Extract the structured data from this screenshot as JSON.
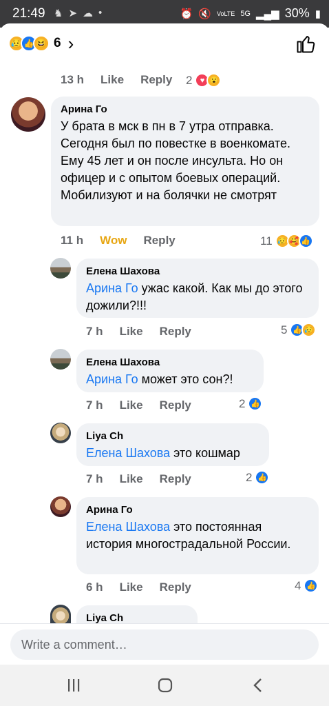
{
  "status": {
    "time": "21:49",
    "network": "5G",
    "lte": "VoLTE",
    "battery": "30%"
  },
  "header": {
    "reaction_count": "6"
  },
  "top_meta": {
    "time": "13 h",
    "like": "Like",
    "reply": "Reply",
    "count": "2"
  },
  "comments": [
    {
      "author": "Арина Го",
      "text": "У брата в мск в пн в 7 утра отправка. Сегодня был по повестке в военкомате. Ему 45 лет и он после инсульта. Но он офицер и с опытом боевых операций. Мобилизуют и на болячки не смотрят",
      "time": "11 h",
      "reaction": "Wow",
      "reply": "Reply",
      "count": "11"
    },
    {
      "author": "Елена Шахова",
      "mention": "Арина Го",
      "text": " ужас какой. Как мы до этого дожили?!!!",
      "time": "7 h",
      "like": "Like",
      "reply": "Reply",
      "count": "5"
    },
    {
      "author": "Елена Шахова",
      "mention": "Арина Го",
      "text": " может это сон?!",
      "time": "7 h",
      "like": "Like",
      "reply": "Reply",
      "count": "2"
    },
    {
      "author": "Liya Ch",
      "mention": "Елена Шахова",
      "text": " это кошмар",
      "time": "7 h",
      "like": "Like",
      "reply": "Reply",
      "count": "2"
    },
    {
      "author": "Арина Го",
      "mention": "Елена Шахова",
      "text": " это постоянная история многострадальной России.",
      "time": "6 h",
      "like": "Like",
      "reply": "Reply",
      "count": "4"
    },
    {
      "author": "Liya Ch"
    }
  ],
  "composer": {
    "placeholder": "Write a comment…"
  }
}
